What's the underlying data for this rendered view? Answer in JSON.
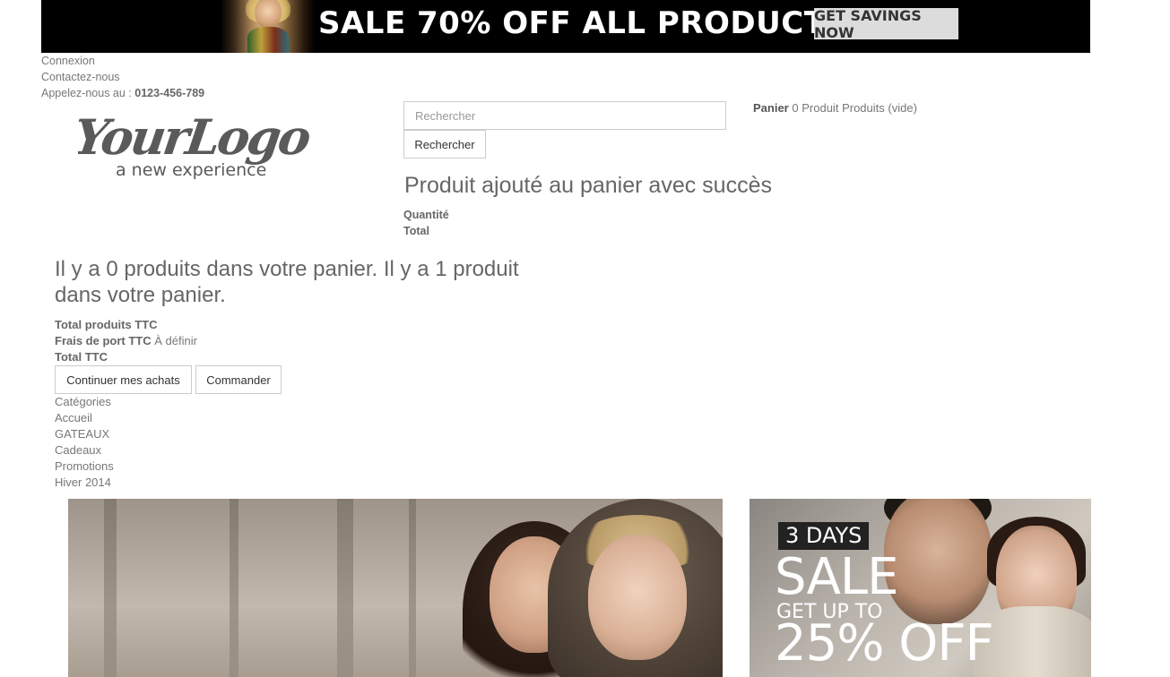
{
  "banner": {
    "text": "SALE 70% OFF ALL PRODUCTS",
    "button": "GET SAVINGS NOW"
  },
  "nav": {
    "login": "Connexion",
    "contact": "Contactez-nous",
    "call_label": "Appelez-nous au :",
    "phone": "0123-456-789"
  },
  "logo": {
    "line1": "YourLogo",
    "line2": "a new experience"
  },
  "search": {
    "placeholder": "Rechercher",
    "button": "Rechercher"
  },
  "cart": {
    "label": "Panier",
    "count": "0",
    "product_word": "Produit",
    "products_word": "Produits",
    "empty": "(vide)"
  },
  "layer_cart": {
    "title": "Produit ajouté au panier avec succès",
    "quantity_label": "Quantité",
    "total_label": "Total",
    "count_message": "Il y a 0 produits dans votre panier. Il y a 1 produit dans votre panier.",
    "total_products_label": "Total produits TTC",
    "shipping_label": "Frais de port TTC",
    "shipping_value": "À définir",
    "total_ttc_label": "Total TTC",
    "continue_button": "Continuer mes achats",
    "order_button": "Commander"
  },
  "categories": {
    "heading": "Catégories",
    "items": [
      "Accueil",
      "GATEAUX",
      "Cadeaux",
      "Promotions",
      "Hiver 2014"
    ]
  },
  "promo": {
    "days": "3 DAYS",
    "sale": "SALE",
    "get_up_to": "GET UP TO",
    "off": "25% OFF"
  },
  "colors": {
    "banner_bg": "#000000",
    "text": "#777777",
    "border": "#cccccc"
  }
}
